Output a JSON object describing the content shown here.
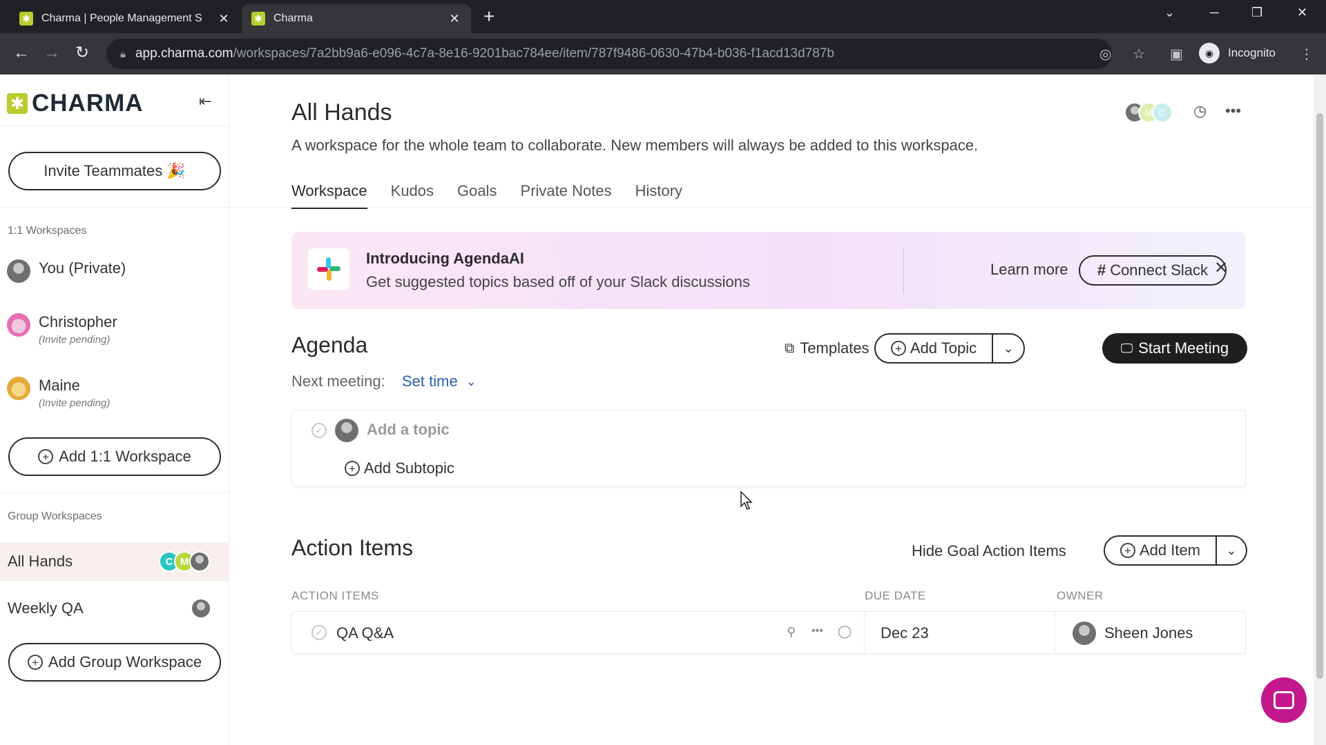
{
  "browser": {
    "tabs": [
      {
        "title": "Charma | People Management S",
        "active": false
      },
      {
        "title": "Charma",
        "active": true
      }
    ],
    "url_host": "app.charma.com",
    "url_path": "/workspaces/7a2bb9a6-e096-4c7a-8e16-9201bac784ee/item/787f9486-0630-47b4-b036-f1acd13d787b",
    "profile_label": "Incognito"
  },
  "sidebar": {
    "brand": "CHARMA",
    "invite_button": "Invite Teammates 🎉",
    "one_on_one_heading": "1:1 Workspaces",
    "people": [
      {
        "name": "You (Private)",
        "sub": ""
      },
      {
        "name": "Christopher",
        "sub": "(Invite pending)"
      },
      {
        "name": "Maine",
        "sub": "(Invite pending)"
      }
    ],
    "add_one_on_one": "Add 1:1 Workspace",
    "group_heading": "Group Workspaces",
    "groups": [
      {
        "name": "All Hands",
        "selected": true,
        "avatars": [
          "C",
          "M",
          ""
        ]
      },
      {
        "name": "Weekly QA",
        "selected": false,
        "avatars": [
          ""
        ]
      }
    ],
    "add_group": "Add Group Workspace"
  },
  "main": {
    "title": "All Hands",
    "description": "A workspace for the whole team to collaborate. New members will always be added to this workspace.",
    "header_avatars": [
      "",
      "M",
      "C"
    ],
    "tabs": [
      {
        "label": "Workspace",
        "active": true
      },
      {
        "label": "Kudos",
        "active": false
      },
      {
        "label": "Goals",
        "active": false
      },
      {
        "label": "Private Notes",
        "active": false
      },
      {
        "label": "History",
        "active": false
      }
    ],
    "banner": {
      "heading": "Introducing AgendaAI",
      "subtext": "Get suggested topics based off of your Slack discussions",
      "learn_more": "Learn more",
      "connect_slack": "Connect Slack"
    },
    "agenda": {
      "title": "Agenda",
      "templates": "Templates",
      "add_topic": "Add Topic",
      "start_meeting": "Start Meeting",
      "next_meeting_label": "Next meeting:",
      "set_time": "Set time",
      "topic_placeholder": "Add a topic",
      "add_subtopic": "Add Subtopic"
    },
    "action_items": {
      "title": "Action Items",
      "hide_goal": "Hide Goal Action Items",
      "add_item": "Add Item",
      "columns": [
        "ACTION ITEMS",
        "DUE DATE",
        "OWNER"
      ],
      "rows": [
        {
          "item": "QA Q&A",
          "due": "Dec 23",
          "owner": "Sheen Jones"
        }
      ]
    }
  },
  "colors": {
    "brand_green": "#b8cc2e",
    "chat_magenta": "#c2188c",
    "avatar_teal": "#2ec4c4",
    "avatar_lime": "#b8d93a"
  }
}
